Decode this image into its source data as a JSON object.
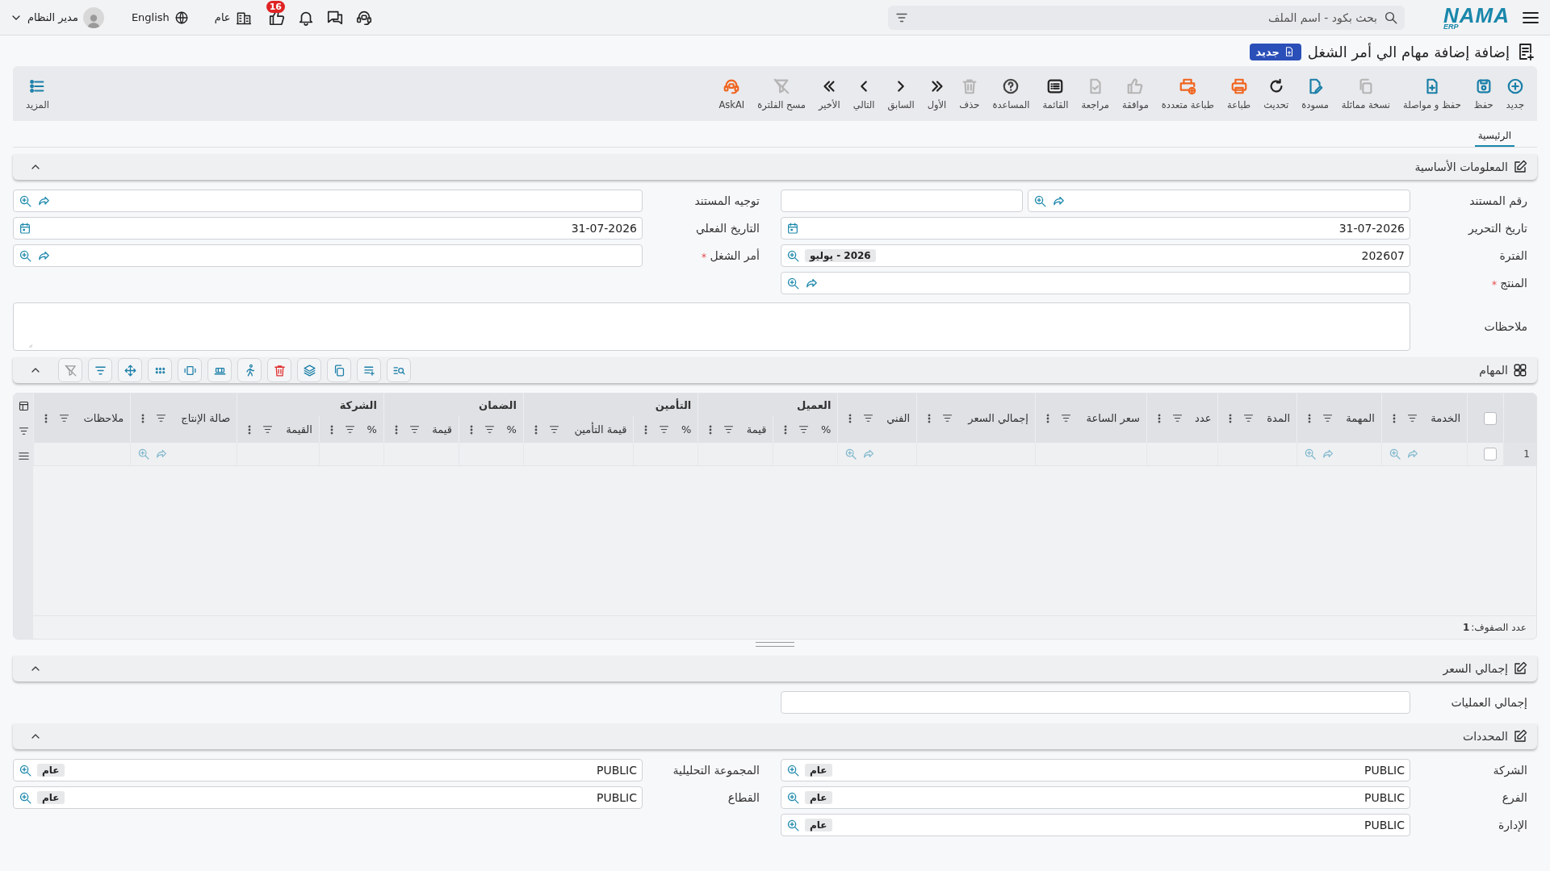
{
  "topbar": {
    "logo": {
      "name": "NAMA",
      "sub": "ERP"
    },
    "search": {
      "placeholder": "بحث بكود - اسم الملف"
    },
    "notifications": "16",
    "company": "عام",
    "language": "English",
    "user": "مدير النظام"
  },
  "page": {
    "title": "إضافة إضافة مهام الي أمر الشغل",
    "badge": "جديد"
  },
  "toolbar": [
    {
      "label": "جديد",
      "color": "#1a7fa8"
    },
    {
      "label": "حفظ",
      "color": "#1a7fa8"
    },
    {
      "label": "حفظ و مواصلة",
      "color": "#1a7fa8"
    },
    {
      "label": "نسخة مماثلة",
      "color": "#b5b5b5"
    },
    {
      "label": "مسودة",
      "color": "#1a7fa8"
    },
    {
      "label": "تحديث",
      "color": "#222222"
    },
    {
      "label": "طباعة",
      "color": "#f0641e"
    },
    {
      "label": "طباعة متعددة",
      "color": "#f0641e"
    },
    {
      "label": "موافقة",
      "color": "#b5b5b5"
    },
    {
      "label": "مراجعة",
      "color": "#b5b5b5"
    },
    {
      "label": "القائمة",
      "color": "#222222"
    },
    {
      "label": "المساعدة",
      "color": "#444444"
    },
    {
      "label": "حذف",
      "color": "#b5b5b5"
    },
    {
      "label": "الأول",
      "color": "#222222"
    },
    {
      "label": "السابق",
      "color": "#222222"
    },
    {
      "label": "التالي",
      "color": "#222222"
    },
    {
      "label": "الأخير",
      "color": "#222222"
    },
    {
      "label": "مسح الفلترة",
      "color": "#b5b5b5"
    },
    {
      "label": "AskAI",
      "color": "#f0641e"
    }
  ],
  "more_button": {
    "label": "المزيد"
  },
  "tabs": [
    {
      "label": "الرئيسية",
      "selected": true
    }
  ],
  "basic_info": {
    "title": "المعلومات الأساسية",
    "expanded": true,
    "right_fields": [
      {
        "label": "رقم المستند",
        "kind": "lookup-pair",
        "required": false
      },
      {
        "label": "تاريخ التحرير",
        "kind": "date",
        "value": "31-07-2026",
        "required": false
      },
      {
        "label": "الفترة",
        "kind": "picker",
        "value": "202607",
        "tag": "2026 - يوليو",
        "required": false
      },
      {
        "label": "المنتج",
        "kind": "lookup",
        "required": true
      }
    ],
    "left_fields": [
      {
        "label": "توجيه المستند",
        "kind": "lookup",
        "required": false
      },
      {
        "label": "التاريخ الفعلي",
        "kind": "date",
        "value": "31-07-2026",
        "required": false
      },
      {
        "label": "أمر الشغل",
        "kind": "lookup",
        "required": true
      }
    ],
    "notes": {
      "label": "ملاحظات"
    }
  },
  "tasks": {
    "title": "المهام",
    "expanded": true,
    "columns": [
      {
        "label": "الخدمة",
        "kind": "lookup"
      },
      {
        "label": "المهمة",
        "kind": "lookup"
      },
      {
        "label": "المدة",
        "kind": "plain"
      },
      {
        "label": "عدد",
        "kind": "plain"
      },
      {
        "label": "سعر الساعة",
        "kind": "plain"
      },
      {
        "label": "إجمالي السعر",
        "kind": "plain"
      },
      {
        "label": "الفني",
        "kind": "lookup"
      },
      {
        "label": "العميل",
        "kind": "group",
        "children": [
          {
            "label": "%"
          },
          {
            "label": "قيمة"
          }
        ]
      },
      {
        "label": "التأمين",
        "kind": "group",
        "children": [
          {
            "label": "%"
          },
          {
            "label": "قيمة التأمين"
          }
        ]
      },
      {
        "label": "الضمان",
        "kind": "group",
        "children": [
          {
            "label": "%"
          },
          {
            "label": "قيمة"
          }
        ]
      },
      {
        "label": "الشركة",
        "kind": "group",
        "children": [
          {
            "label": "%"
          },
          {
            "label": "القيمة"
          }
        ]
      },
      {
        "label": "صالة الإنتاج",
        "kind": "lookup"
      },
      {
        "label": "ملاحظات",
        "kind": "plain"
      }
    ],
    "all_selected": false,
    "rows": [
      {
        "number": "1",
        "checked": false
      }
    ],
    "row_count_label": "عدد الصفوف:",
    "row_count": "1"
  },
  "price_total": {
    "title": "إجمالي السعر",
    "expanded": true,
    "right_fields": [
      {
        "label": "إجمالي العمليات",
        "kind": "text",
        "required": false
      }
    ]
  },
  "dimensions": {
    "title": "المحددات",
    "expanded": true,
    "right_fields": [
      {
        "label": "الشركة",
        "kind": "picker",
        "value": "PUBLIC",
        "tag": "عام",
        "required": false
      },
      {
        "label": "الفرع",
        "kind": "picker",
        "value": "PUBLIC",
        "tag": "عام",
        "required": false
      },
      {
        "label": "الإدارة",
        "kind": "picker",
        "value": "PUBLIC",
        "tag": "عام",
        "required": false
      }
    ],
    "left_fields": [
      {
        "label": "المجموعة التحليلية",
        "kind": "picker",
        "value": "PUBLIC",
        "tag": "عام",
        "required": false
      },
      {
        "label": "القطاع",
        "kind": "picker",
        "value": "PUBLIC",
        "tag": "عام",
        "required": false
      }
    ]
  }
}
